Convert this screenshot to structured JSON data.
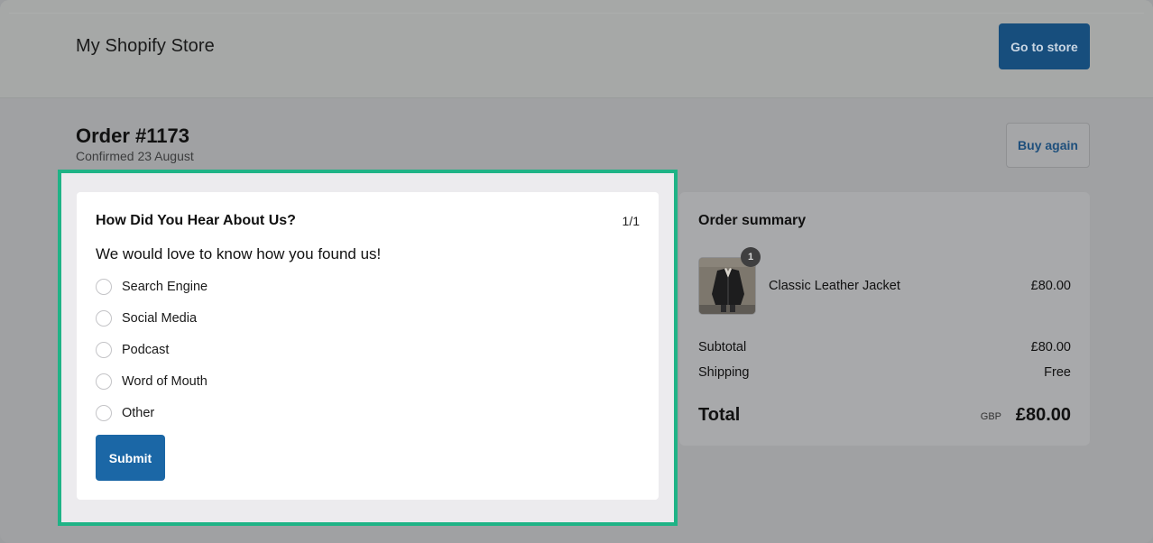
{
  "header": {
    "store_name": "My Shopify Store",
    "go_to_store_label": "Go to store"
  },
  "order": {
    "title": "Order #1173",
    "confirmed": "Confirmed 23 August",
    "buy_again_label": "Buy again"
  },
  "survey": {
    "title": "How Did You Hear About Us?",
    "page_indicator": "1/1",
    "prompt": "We would love to know how you found us!",
    "options": [
      {
        "label": "Search Engine",
        "selected": false
      },
      {
        "label": "Social Media",
        "selected": false
      },
      {
        "label": "Podcast",
        "selected": false
      },
      {
        "label": "Word of Mouth",
        "selected": false
      },
      {
        "label": "Other",
        "selected": false
      }
    ],
    "submit_label": "Submit"
  },
  "summary": {
    "title": "Order summary",
    "item": {
      "name": "Classic Leather Jacket",
      "price": "£80.00",
      "quantity": "1"
    },
    "subtotal_label": "Subtotal",
    "subtotal_value": "£80.00",
    "shipping_label": "Shipping",
    "shipping_value": "Free",
    "total_label": "Total",
    "total_currency": "GBP",
    "total_value": "£80.00"
  },
  "colors": {
    "highlight_border": "#1fb386",
    "primary_button": "#1b67a6",
    "overlay_button": "#174e7d"
  }
}
